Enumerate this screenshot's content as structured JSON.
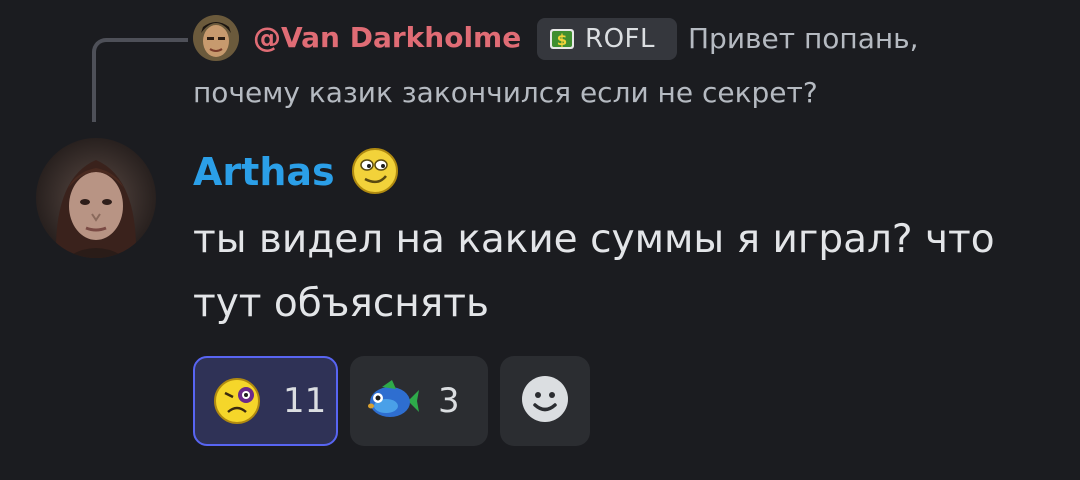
{
  "reply": {
    "author": "@Van Darkholme",
    "tag_label": "ROFL",
    "text_line_1": "Привет попань,",
    "text_line_2": "почему казик закончился если не секрет?",
    "author_color": "#e06c75"
  },
  "message": {
    "author": "Arthas",
    "author_color": "#2b9fe8",
    "author_badge_icon": "smug-face-emoji",
    "text_line_1": "ты видел на какие суммы я играл? что",
    "text_line_2": "тут объяснять"
  },
  "reactions": [
    {
      "emoji_name": "bruised-face-emoji",
      "count": "11",
      "active": true
    },
    {
      "emoji_name": "blue-fish-emoji",
      "count": "3",
      "active": false
    }
  ],
  "add_reaction_icon": "add-reaction-smile-icon",
  "colors": {
    "background": "#1b1c20",
    "accent": "#5865f2",
    "reaction_bg": "#2b2d31"
  }
}
